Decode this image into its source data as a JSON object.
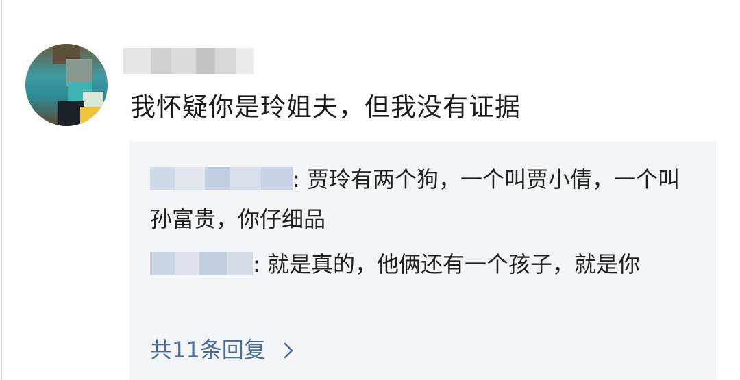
{
  "comment": {
    "text": "我怀疑你是玲姐夫，但我没有证据"
  },
  "replies": [
    {
      "separator": ": ",
      "text": "贾玲有两个狗，一个叫贾小倩，一个叫孙富贵，你仔细品"
    },
    {
      "separator": ": ",
      "text": "就是真的，他俩还有一个孩子，就是你"
    }
  ],
  "more_replies": {
    "label": "共11条回复",
    "icon": "chevron-right-icon"
  },
  "colors": {
    "reply_bg": "#f4f5f7",
    "link": "#486c9c",
    "text": "#1f1f1f"
  }
}
